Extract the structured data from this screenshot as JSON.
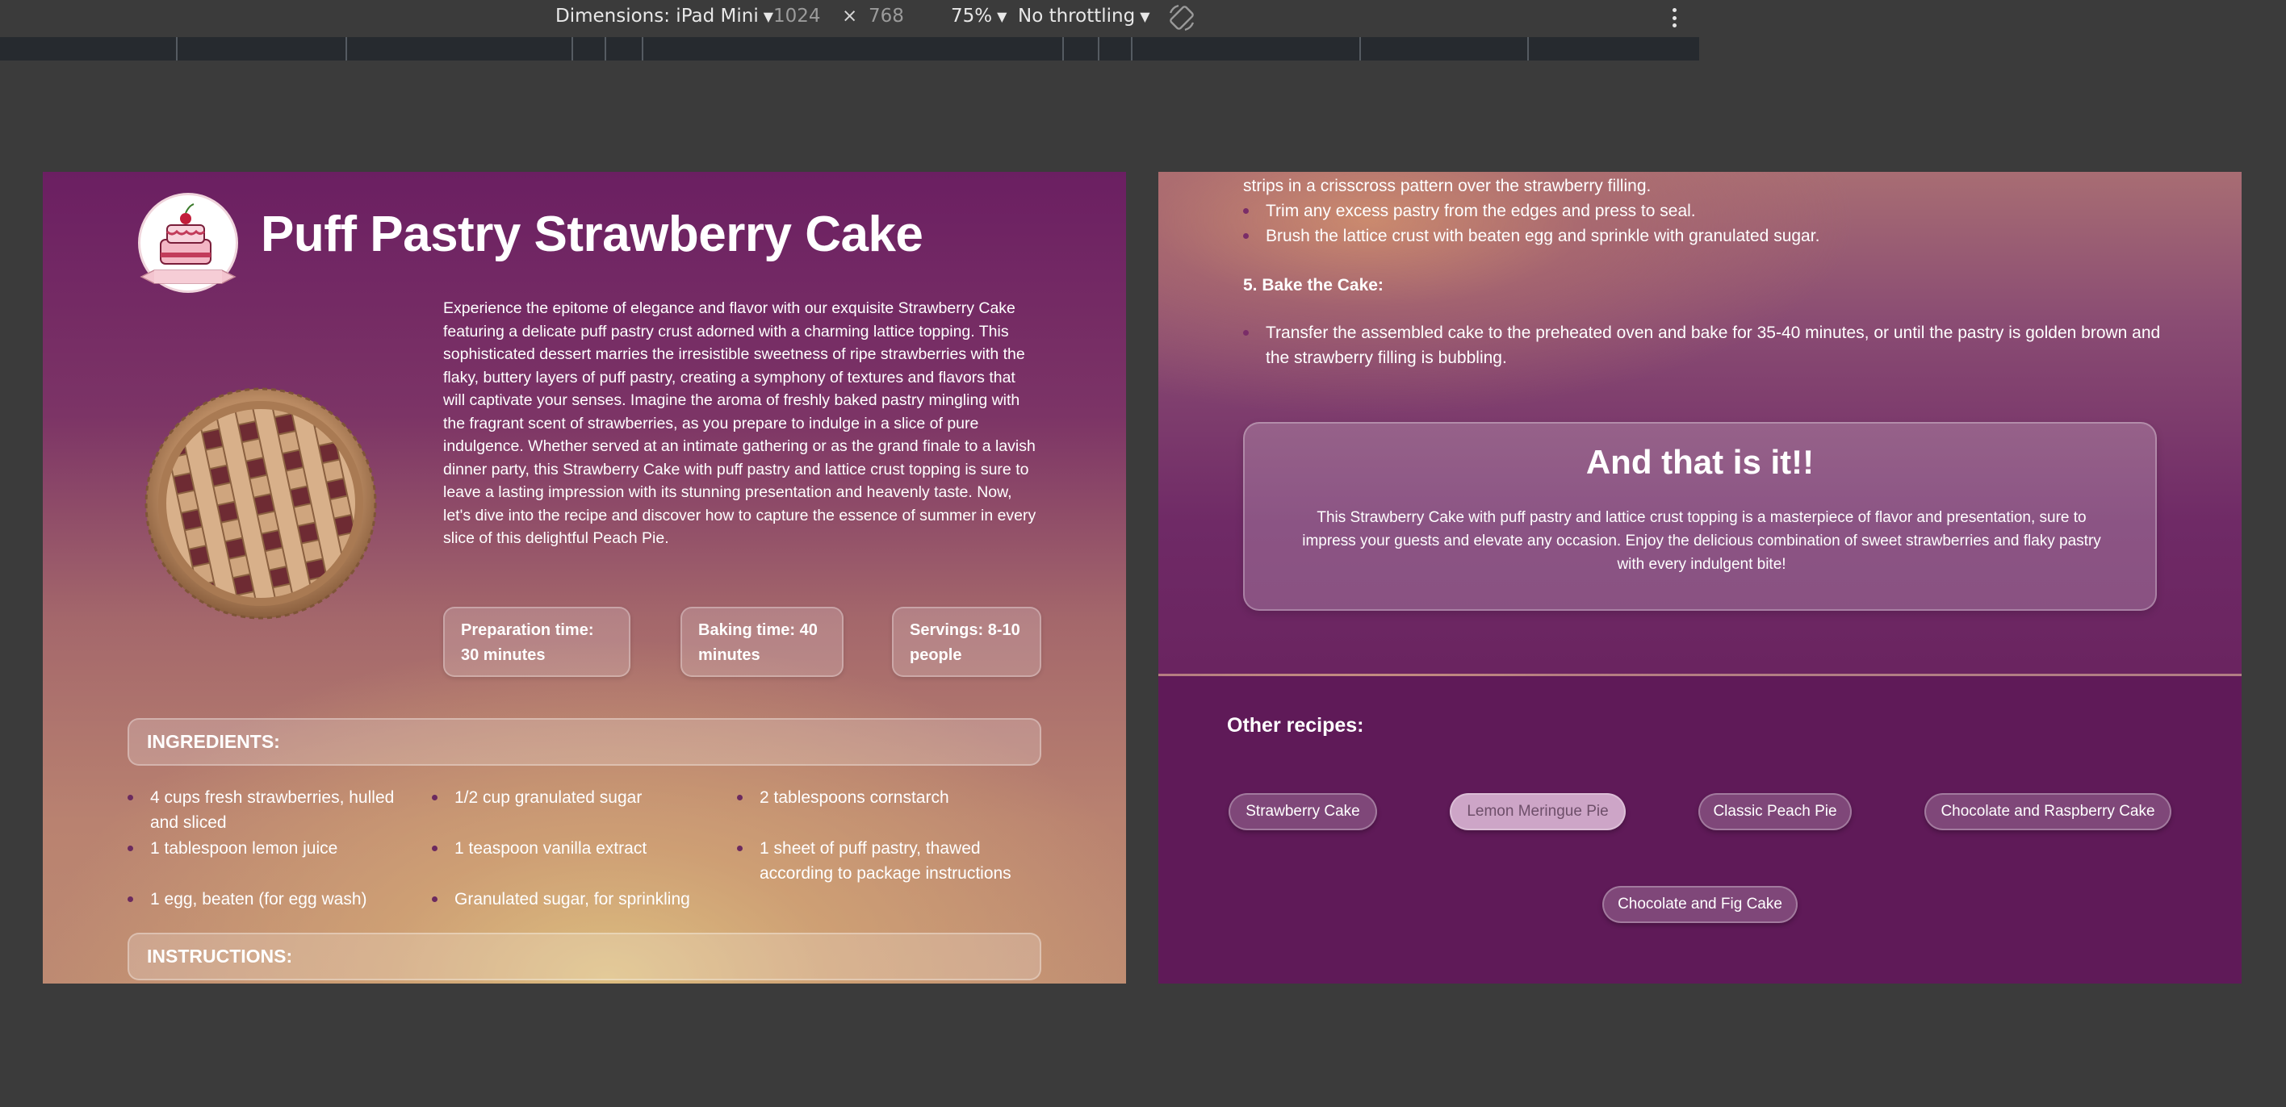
{
  "devtools": {
    "dimensions_label": "Dimensions: iPad Mini",
    "width": "1024",
    "times": "×",
    "height": "768",
    "zoom": "75%",
    "throttling": "No throttling",
    "icons": [
      "caret-down-icon",
      "rotate-icon",
      "more-options-icon"
    ]
  },
  "page": {
    "title": "Puff Pastry Strawberry Cake",
    "intro": "Experience the epitome of elegance and flavor with our exquisite Strawberry Cake featuring a delicate puff pastry crust adorned with a charming lattice topping. This sophisticated dessert marries the irresistible sweetness of ripe strawberries with the flaky, buttery layers of puff pastry, creating a symphony of textures and flavors that will captivate your senses. Imagine the aroma of freshly baked pastry mingling with the fragrant scent of strawberries, as you prepare to indulge in a slice of pure indulgence. Whether served at an intimate gathering or as the grand finale to a lavish dinner party, this Strawberry Cake with puff pastry and lattice crust topping is sure to leave a lasting impression with its stunning presentation and heavenly taste. Now, let's dive into the recipe and discover how to capture the essence of summer in every slice of this delightful Peach Pie.",
    "stats": {
      "prep": "Preparation time: 30 minutes",
      "baking": "Baking time: 40 minutes",
      "servings": "Servings: 8-10 people"
    },
    "ingredients_heading": "INGREDIENTS:",
    "ingredients": [
      "4 cups fresh strawberries, hulled and sliced",
      "1/2 cup granulated sugar",
      "2 tablespoons cornstarch",
      "1 tablespoon lemon juice",
      "1 teaspoon vanilla extract",
      "1 sheet of puff pastry, thawed according to package instructions",
      "1 egg, beaten (for egg wash)",
      "Granulated sugar, for sprinkling"
    ],
    "instructions_heading": "INSTRUCTIONS:"
  },
  "page2": {
    "lattice_cont": "strips in a crisscross pattern over the strawberry filling.",
    "step4_bullets": [
      "Trim any excess pastry from the edges and press to seal.",
      "Brush the lattice crust with beaten egg and sprinkle with granulated sugar."
    ],
    "step5_heading": "5. Bake the Cake:",
    "step5_bullet": "Transfer the assembled cake to the preheated oven and bake for 35-40 minutes, or until the pastry is golden brown and the strawberry filling is bubbling.",
    "final_title": "And that is it!!",
    "final_text": "This Strawberry Cake with puff pastry and lattice crust topping is a masterpiece of flavor and presentation, sure to impress your guests and elevate any occasion. Enjoy the delicious combination of sweet strawberries and flaky pastry with every indulgent bite!",
    "other_title": "Other recipes:",
    "other_recipes": [
      "Strawberry Cake",
      "Lemon Meringue Pie",
      "Classic Peach Pie",
      "Chocolate and Raspberry Cake",
      "Chocolate and Fig Cake"
    ],
    "active_recipe": "Lemon Meringue Pie"
  },
  "colors": {
    "background": "#3b3b3b",
    "page_purple": "#6b1f62",
    "footer_purple": "#5f1a58",
    "accent_gold": "#dec080"
  }
}
